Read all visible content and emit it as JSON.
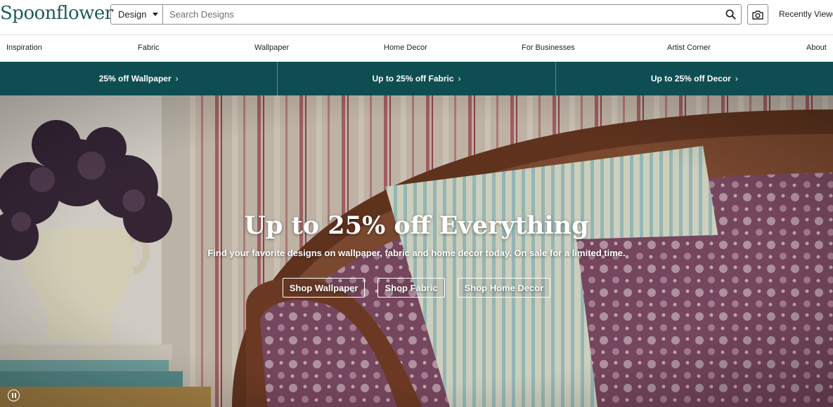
{
  "header": {
    "logo": "Spoonflower",
    "search_select": "Design",
    "search_placeholder": "Search Designs",
    "recently_viewed": "Recently Viewed"
  },
  "nav": {
    "items": [
      "Inspiration",
      "Fabric",
      "Wallpaper",
      "Home Decor",
      "For Businesses",
      "Artist Corner",
      "About"
    ]
  },
  "promo": {
    "items": [
      "25% off Wallpaper",
      "Up to 25% off Fabric",
      "Up to 25% off Decor"
    ],
    "chevron": "›"
  },
  "hero": {
    "title": "Up to 25% off Everything",
    "subtitle": "Find your favorite designs on wallpaper, fabric and home decor today. On sale for a limited time.",
    "buttons": [
      "Shop Wallpaper",
      "Shop Fabric",
      "Shop Home Decor"
    ]
  },
  "colors": {
    "brand": "#1f5b5c",
    "promo_bg": "#0e4e52"
  }
}
